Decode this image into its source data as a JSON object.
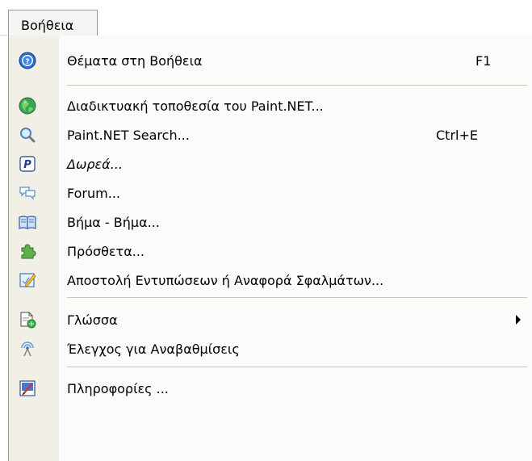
{
  "menu": {
    "title": "Βοήθεια"
  },
  "items": [
    {
      "label": "Θέματα στη Βοήθεια",
      "shortcut": "F1",
      "icon": "help-icon"
    },
    {
      "label": "Διαδικτυακή τοποθεσία του Paint.NET...",
      "shortcut": "",
      "icon": "globe-icon"
    },
    {
      "label": "Paint.NET Search...",
      "shortcut": "Ctrl+E",
      "icon": "magnifier-icon"
    },
    {
      "label": "Δωρεά...",
      "shortcut": "",
      "icon": "paypal-icon"
    },
    {
      "label": "Forum...",
      "shortcut": "",
      "icon": "speech-bubbles-icon"
    },
    {
      "label": "Βήμα - Βήμα...",
      "shortcut": "",
      "icon": "open-book-icon"
    },
    {
      "label": "Πρόσθετα...",
      "shortcut": "",
      "icon": "puzzle-piece-icon"
    },
    {
      "label": "Αποστολή Εντυπώσεων ή Αναφορά Σφαλμάτων...",
      "shortcut": "",
      "icon": "feedback-form-icon"
    },
    {
      "label": "Γλώσσα",
      "shortcut": "",
      "icon": "language-document-icon",
      "submenu": true
    },
    {
      "label": "Έλεγχος για Αναβαθμίσεις",
      "shortcut": "",
      "icon": "update-antenna-icon"
    },
    {
      "label": "Πληροφορίες ...",
      "shortcut": "",
      "icon": "about-icon"
    }
  ],
  "colors": {
    "accent_blue": "#1f6fd1",
    "icon_strip": "#f1efe6",
    "menu_background": "#fbfbf9",
    "separator": "#c8c6be"
  }
}
